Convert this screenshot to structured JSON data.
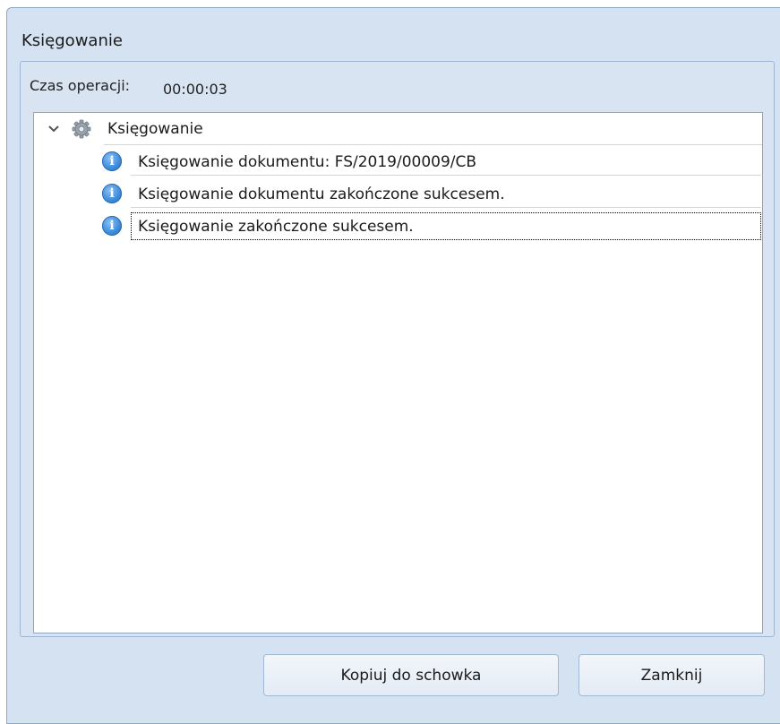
{
  "window": {
    "title": "Księgowanie"
  },
  "operation": {
    "time_label": "Czas operacji:",
    "time_value": "00:00:03"
  },
  "tree": {
    "root": {
      "label": "Księgowanie",
      "icon": "gear-icon",
      "expanded": true
    },
    "items": [
      {
        "label": "Księgowanie dokumentu: FS/2019/00009/CB",
        "icon": "info-icon"
      },
      {
        "label": "Księgowanie dokumentu zakończone sukcesem.",
        "icon": "info-icon"
      },
      {
        "label": "Księgowanie zakończone sukcesem.",
        "icon": "info-icon",
        "focused": true
      }
    ]
  },
  "buttons": {
    "copy": "Kopiuj do schowka",
    "close": "Zamknij"
  }
}
